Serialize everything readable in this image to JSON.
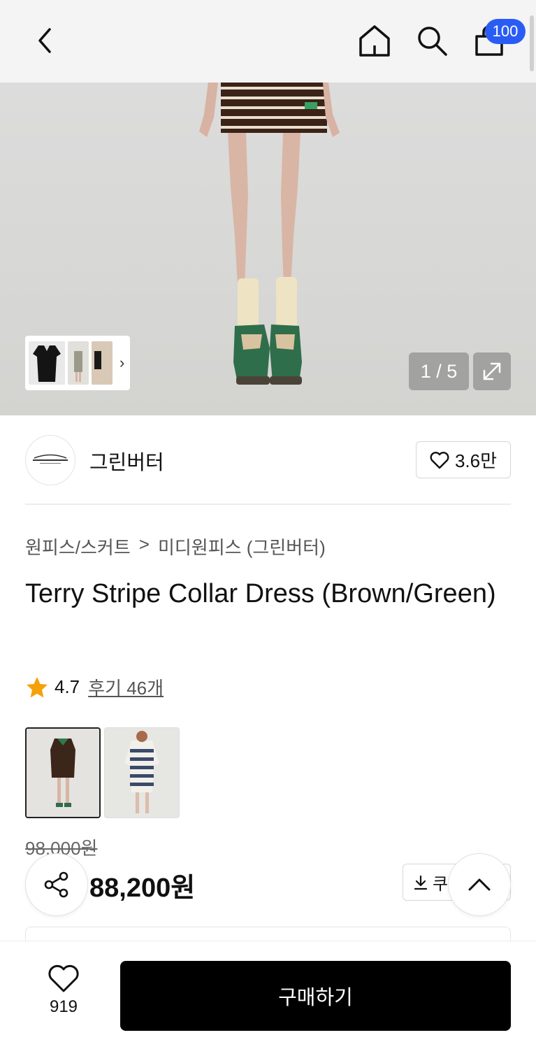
{
  "header": {
    "cart_count": "100",
    "icons": [
      "back-icon",
      "home-icon",
      "search-icon",
      "cart-icon"
    ]
  },
  "gallery": {
    "counter": "1 / 5",
    "icons": [
      "chevron-right-icon",
      "expand-icon"
    ]
  },
  "brand": {
    "name": "그린버터",
    "likes": "3.6만"
  },
  "breadcrumb": {
    "category": "원피스/스커트",
    "separator": ">",
    "subcategory": "미디원피스 (그린버터)"
  },
  "product": {
    "title": "Terry Stripe Collar Dress (Brown/Green)",
    "rating": "4.7",
    "reviews": "후기 46개",
    "original_price": "98,000원",
    "sale_price": "88,200원",
    "coupon_label": "쿠폰"
  },
  "bottom_bar": {
    "wish_count": "919",
    "buy_label": "구매하기"
  },
  "colors": {
    "accent_badge": "#2a5cf5",
    "buy_button": "#000000",
    "star": "#f5a10a"
  }
}
